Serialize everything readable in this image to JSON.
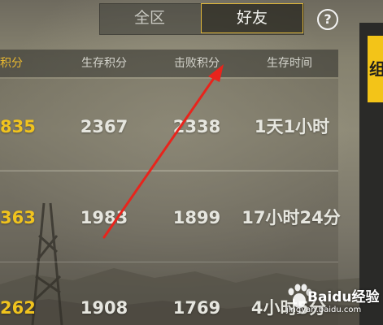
{
  "tabs": [
    {
      "label": "全区",
      "selected": false
    },
    {
      "label": "好友",
      "selected": true
    }
  ],
  "help_label": "?",
  "columns": [
    "总积分",
    "生存积分",
    "击败积分",
    "生存时间"
  ],
  "rows": [
    {
      "total": "835",
      "survival": "2367",
      "kill": "2338",
      "time": "1天1小时"
    },
    {
      "total": "363",
      "survival": "1983",
      "kill": "1899",
      "time": "17小时24分"
    },
    {
      "total": "262",
      "survival": "1908",
      "kill": "1769",
      "time": "4小时5分"
    }
  ],
  "right_card_label": "组",
  "watermark": {
    "brand": "Baidu经验",
    "url": "jingyan.baidu.com"
  },
  "colors": {
    "accent": "#f0c31e",
    "tab_border": "#e0b73a",
    "arrow": "#e8241c"
  }
}
